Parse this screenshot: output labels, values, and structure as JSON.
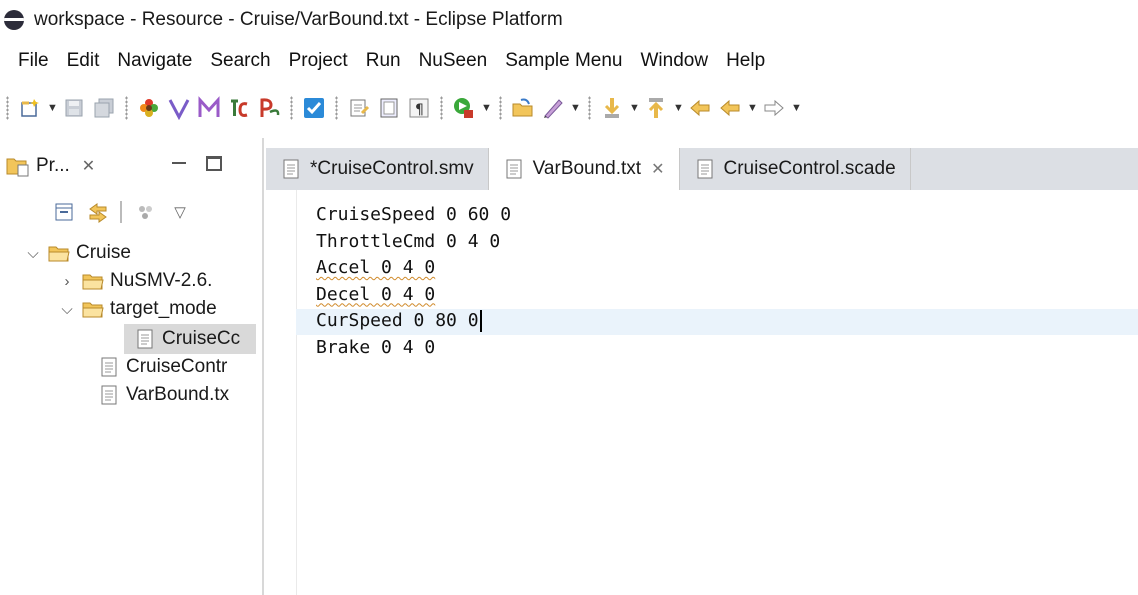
{
  "window": {
    "title": "workspace - Resource - Cruise/VarBound.txt - Eclipse Platform"
  },
  "menu": [
    "File",
    "Edit",
    "Navigate",
    "Search",
    "Project",
    "Run",
    "NuSeen",
    "Sample Menu",
    "Window",
    "Help"
  ],
  "project_view": {
    "tab_label": "Pr...",
    "tree": {
      "root": "Cruise",
      "nusmv_folder": "NuSMV-2.6.",
      "target_folder": "target_mode",
      "target_child": "CruiseCc",
      "file1": "CruiseContr",
      "file2": "VarBound.tx"
    }
  },
  "editor": {
    "tabs": [
      {
        "label": "*CruiseControl.smv",
        "active": false
      },
      {
        "label": "VarBound.txt",
        "active": true
      },
      {
        "label": "CruiseControl.scade",
        "active": false
      }
    ],
    "lines": [
      "CruiseSpeed 0 60 0",
      "ThrottleCmd 0 4 0",
      "Accel 0 4 0",
      "Decel 0 4 0",
      "CurSpeed 0 80 0",
      "Brake 0 4 0"
    ]
  },
  "colors": {
    "editor_tab_bar": "#dcdfe4",
    "current_line": "#eaf3fb",
    "folder": "#e8b84a"
  }
}
